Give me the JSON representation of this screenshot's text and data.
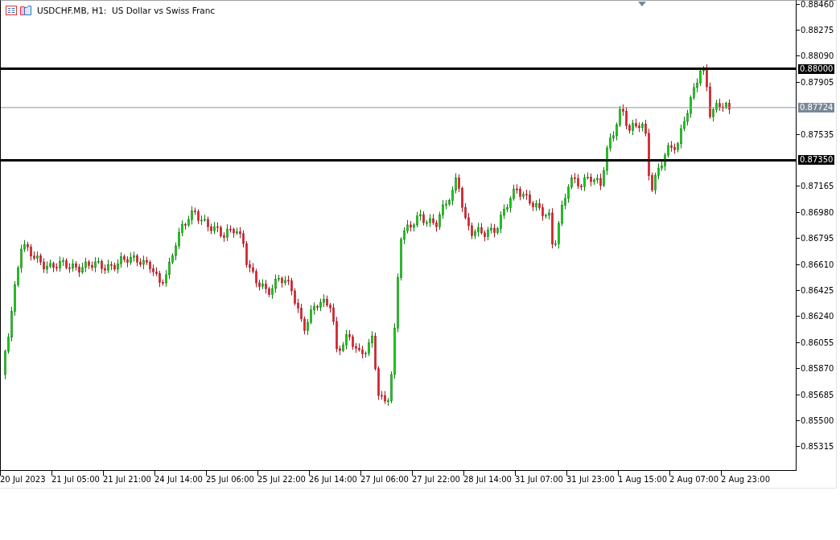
{
  "window": {
    "title": "USDCHF.MB, H1:  US Dollar vs Swiss Franc"
  },
  "price_axis": [
    "0.88460",
    "0.88275",
    "0.88090",
    "0.87905",
    "0.87535",
    "0.87165",
    "0.86980",
    "0.86795",
    "0.86610",
    "0.86425",
    "0.86240",
    "0.86055",
    "0.85870",
    "0.85685",
    "0.85500",
    "0.85315"
  ],
  "levels": [
    {
      "label": "0.88000",
      "kind": "horizontal-line"
    },
    {
      "label": "0.87724",
      "kind": "current-price"
    },
    {
      "label": "0.87350",
      "kind": "horizontal-line"
    }
  ],
  "time_axis": [
    "20 Jul 2023",
    "21 Jul 05:00",
    "21 Jul 21:00",
    "24 Jul 14:00",
    "25 Jul 06:00",
    "25 Jul 22:00",
    "26 Jul 14:00",
    "27 Jul 06:00",
    "27 Jul 22:00",
    "28 Jul 14:00",
    "31 Jul 07:00",
    "31 Jul 23:00",
    "1 Aug 15:00",
    "2 Aug 07:00",
    "2 Aug 23:00"
  ]
}
